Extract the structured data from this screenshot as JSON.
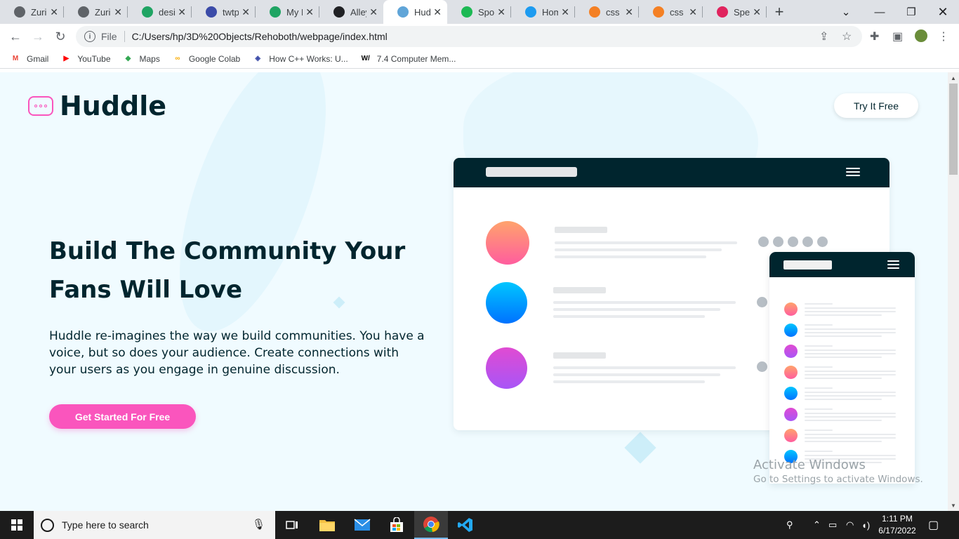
{
  "browser": {
    "tabs": [
      {
        "title": "ZuriB",
        "icon": "globe-icon",
        "color": "#5f6368"
      },
      {
        "title": "ZuriB",
        "icon": "globe-icon",
        "color": "#5f6368"
      },
      {
        "title": "desig",
        "icon": "drive-icon",
        "color": "#1fa463"
      },
      {
        "title": "twtp",
        "icon": "site-icon",
        "color": "#3b4ba8"
      },
      {
        "title": "My D",
        "icon": "drive-icon",
        "color": "#1fa463"
      },
      {
        "title": "Alley",
        "icon": "github-icon",
        "color": "#202124"
      },
      {
        "title": "Hudd",
        "icon": "huddle-icon",
        "color": "#60a5d8"
      },
      {
        "title": "Spoti",
        "icon": "spotify-icon",
        "color": "#1db954"
      },
      {
        "title": "Hom",
        "icon": "twitter-icon",
        "color": "#1d9bf0"
      },
      {
        "title": "css -",
        "icon": "stackoverflow-icon",
        "color": "#f48024"
      },
      {
        "title": "css -",
        "icon": "stackoverflow-icon",
        "color": "#f48024"
      },
      {
        "title": "Spec",
        "icon": "brush-icon",
        "color": "#e0245e"
      }
    ],
    "active_tab": 6,
    "address_scheme": "File",
    "address": "C:/Users/hp/3D%20Objects/Rehoboth/webpage/index.html",
    "bookmarks": [
      {
        "label": "Gmail",
        "icon": "gmail-icon"
      },
      {
        "label": "YouTube",
        "icon": "youtube-icon"
      },
      {
        "label": "Maps",
        "icon": "maps-icon"
      },
      {
        "label": "Google Colab",
        "icon": "colab-icon"
      },
      {
        "label": "How C++ Works: U...",
        "icon": "bookmark-site-icon"
      },
      {
        "label": "7.4 Computer Mem...",
        "icon": "w-icon"
      }
    ]
  },
  "page": {
    "brand": "Huddle",
    "try_button": "Try It Free",
    "hero_title": "Build The Community Your Fans Will Love",
    "hero_text": "Huddle re-imagines the way we build communities. You have a voice, but so does your audience. Create connections with your users as you engage in genuine discussion.",
    "cta_button": "Get Started For Free",
    "colors": {
      "primary": "#00252e",
      "accent": "#fa55bd",
      "background": "#f0fbff"
    }
  },
  "watermark": {
    "line1": "Activate Windows",
    "line2": "Go to Settings to activate Windows."
  },
  "taskbar": {
    "search_placeholder": "Type here to search",
    "time": "1:11 PM",
    "date": "6/17/2022"
  }
}
